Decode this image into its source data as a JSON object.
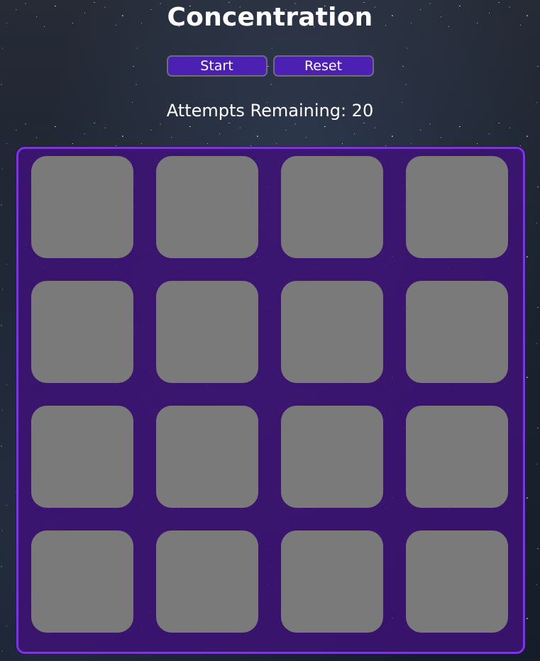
{
  "game": {
    "title": "Concentration",
    "status": "Attempts Remaining: 20"
  },
  "controls": {
    "start_label": "Start",
    "reset_label": "Reset"
  },
  "board": {
    "rows": 4,
    "columns": 4,
    "cards": [
      {
        "state": "face-down"
      },
      {
        "state": "face-down"
      },
      {
        "state": "face-down"
      },
      {
        "state": "face-down"
      },
      {
        "state": "face-down"
      },
      {
        "state": "face-down"
      },
      {
        "state": "face-down"
      },
      {
        "state": "face-down"
      },
      {
        "state": "face-down"
      },
      {
        "state": "face-down"
      },
      {
        "state": "face-down"
      },
      {
        "state": "face-down"
      },
      {
        "state": "face-down"
      },
      {
        "state": "face-down"
      },
      {
        "state": "face-down"
      },
      {
        "state": "face-down"
      }
    ]
  },
  "colors": {
    "button_fill": "#4b20b3",
    "board_border": "#7b33ee",
    "board_fill": "#3e1278",
    "card_back": "#7a7a7a"
  }
}
